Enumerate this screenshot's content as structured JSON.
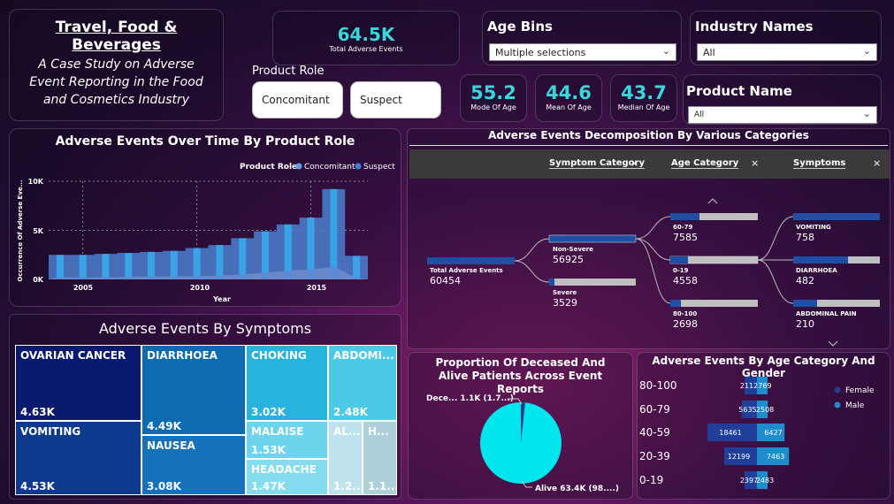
{
  "header": {
    "title": "Travel, Food & Beverages",
    "subtitle": "A Case Study on Adverse Event Reporting in the Food and Cosmetics Industry"
  },
  "kpis": {
    "total": {
      "value": "64.5K",
      "label": "Total Adverse Events"
    },
    "mode_age": {
      "value": "55.2",
      "label": "Mode Of Age"
    },
    "mean_age": {
      "value": "44.6",
      "label": "Mean Of Age"
    },
    "median_age": {
      "value": "43.7",
      "label": "Median Of Age"
    }
  },
  "product_role": {
    "label": "Product Role",
    "buttons": [
      "Concomitant",
      "Suspect"
    ]
  },
  "slicers": {
    "age_bins": {
      "label": "Age Bins",
      "value": "Multiple selections"
    },
    "industry": {
      "label": "Industry Names",
      "value": "All"
    },
    "product": {
      "label": "Product Name",
      "value": "All"
    }
  },
  "time_chart": {
    "title": "Adverse Events Over Time By Product Role",
    "legend_title": "Product Role",
    "legend": [
      "Concomitant",
      "Suspect"
    ],
    "ylabel": "Occurrence Of Adverse Eve...",
    "xlabel": "Year",
    "yticks": [
      "10K",
      "5K",
      "0K"
    ],
    "xticks": [
      "2005",
      "2010",
      "2015"
    ]
  },
  "chart_data": {
    "type": "bar",
    "title": "Adverse Events Over Time By Product Role",
    "xlabel": "Year",
    "ylabel": "Occurrence Of Adverse Eve...",
    "ylim": [
      0,
      10000
    ],
    "categories": [
      2004,
      2005,
      2006,
      2007,
      2008,
      2009,
      2010,
      2011,
      2012,
      2013,
      2014,
      2015,
      2016,
      2017
    ],
    "series": [
      {
        "name": "Suspect",
        "values": [
          2500,
          2500,
          2600,
          2700,
          2800,
          2900,
          3200,
          3500,
          4200,
          4900,
          5600,
          6300,
          9200,
          2400
        ]
      },
      {
        "name": "Concomitant",
        "values": [
          200,
          200,
          200,
          250,
          300,
          300,
          300,
          400,
          500,
          700,
          900,
          1000,
          1300,
          150
        ]
      }
    ]
  },
  "decomp": {
    "title": "Adverse Events Decomposition By Various Categories",
    "headers": [
      "Symptom Category",
      "Age Category",
      "Symptoms"
    ],
    "root": {
      "label": "Total Adverse Events",
      "value": "60454"
    },
    "level1": [
      {
        "label": "Non-Severe",
        "value": "56925"
      },
      {
        "label": "Severe",
        "value": "3529"
      }
    ],
    "level2": [
      {
        "label": "60-79",
        "value": "7585"
      },
      {
        "label": "0-19",
        "value": "4558"
      },
      {
        "label": "80-100",
        "value": "2698"
      }
    ],
    "level3": [
      {
        "label": "VOMITING",
        "value": "758"
      },
      {
        "label": "DIARRHOEA",
        "value": "482"
      },
      {
        "label": "ABDOMINAL PAIN",
        "value": "210"
      }
    ]
  },
  "symptoms": {
    "title": "Adverse Events By Symptoms",
    "cells": [
      {
        "label": "OVARIAN CANCER",
        "value": "4.63K"
      },
      {
        "label": "VOMITING",
        "value": "4.53K"
      },
      {
        "label": "DIARRHOEA",
        "value": "4.49K"
      },
      {
        "label": "NAUSEA",
        "value": "3.08K"
      },
      {
        "label": "CHOKING",
        "value": "3.02K"
      },
      {
        "label": "ABDOMI...",
        "value": "2.48K"
      },
      {
        "label": "MALAISE",
        "value": "1.53K"
      },
      {
        "label": "HEADACHE",
        "value": "1.47K"
      },
      {
        "label": "AL...",
        "value": "1.2..."
      },
      {
        "label": "H...",
        "value": "1.1..."
      }
    ]
  },
  "pie": {
    "title": "Proportion Of Deceased And Alive Patients Across Event Reports",
    "deceased_label": "Dece... 1.1K (1.7...)",
    "alive_label": "Alive 63.4K (98....)",
    "deceased_fraction": 0.017,
    "color": "#00e5ee"
  },
  "age_gender": {
    "title": "Adverse Events By Age Category And Gender",
    "legend": [
      "Female",
      "Male"
    ],
    "rows": [
      {
        "age": "80-100",
        "female": "2112",
        "male": "769",
        "f": 2112,
        "m": 769
      },
      {
        "age": "60-79",
        "female": "5635",
        "male": "2508",
        "f": 5635,
        "m": 2508
      },
      {
        "age": "40-59",
        "female": "18461",
        "male": "6427",
        "f": 18461,
        "m": 6427
      },
      {
        "age": "20-39",
        "female": "12199",
        "male": "7463",
        "f": 12199,
        "m": 7463
      },
      {
        "age": "0-19",
        "female": "2397",
        "male": "2483",
        "f": 2397,
        "m": 2483
      }
    ]
  }
}
